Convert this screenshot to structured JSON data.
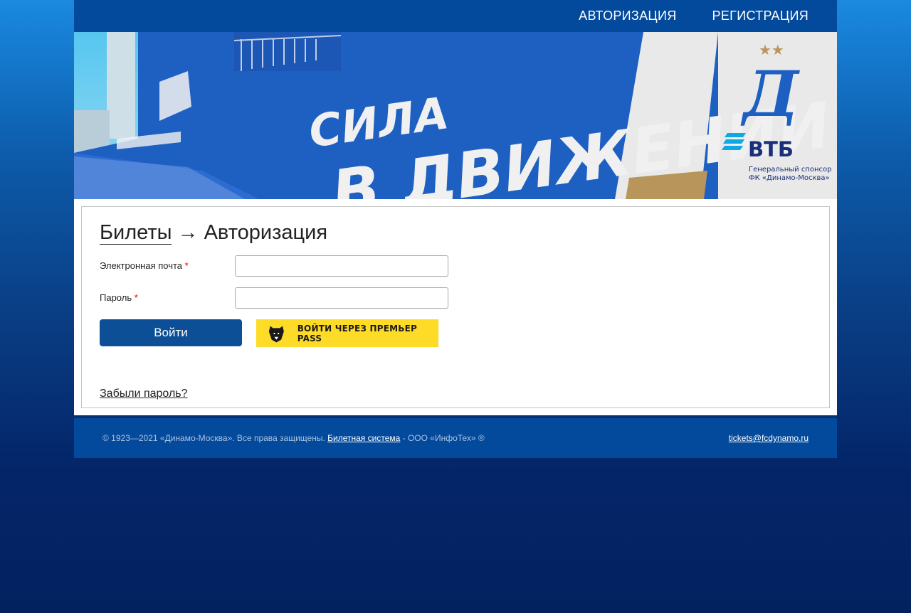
{
  "nav": {
    "items": [
      {
        "label": "АВТОРИЗАЦИЯ"
      },
      {
        "label": "РЕГИСТРАЦИЯ"
      }
    ]
  },
  "banner": {
    "slogan_line1": "СИЛА",
    "slogan_line2": "В ДВИЖЕНИИ",
    "club_logo_letter": "Д",
    "sponsor_name": "ВТБ",
    "sponsor_caption_line1": "Генеральный спонсор",
    "sponsor_caption_line2": "ФК «Динамо-Москва»",
    "colors": {
      "blue": "#1e5fc2",
      "gold": "#b8955a"
    }
  },
  "page": {
    "breadcrumb_link": "Билеты",
    "arrow": "→",
    "title": "Авторизация"
  },
  "form": {
    "email_label": "Электронная почта",
    "password_label": "Пароль",
    "required_mark": "*",
    "email_value": "",
    "password_value": "",
    "login_button": "Войти",
    "premier_pass_button": "ВОЙТИ ЧЕРЕЗ ПРЕМЬЕР PASS",
    "forgot_link": "Забыли пароль?"
  },
  "footer": {
    "copyright": "© 1923—2021 «Динамо-Москва». Все права защищены.",
    "system_link": "Билетная система",
    "company": "- ООО «ИнфоТех» ®",
    "email": "tickets@fcdynamo.ru"
  },
  "colors": {
    "nav_bg": "#034a9c",
    "login_button": "#0d4f96",
    "pass_button": "#fddb26"
  }
}
